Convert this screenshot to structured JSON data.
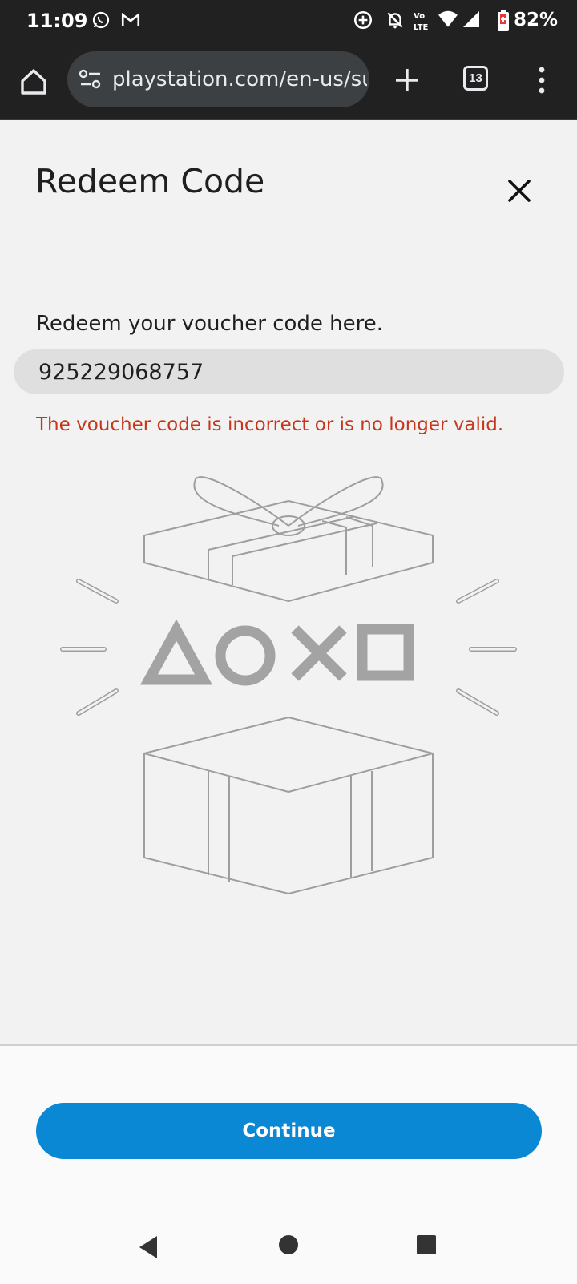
{
  "status_bar": {
    "time": "11:09",
    "battery": "82%",
    "icons": [
      "whatsapp-icon",
      "gmail-icon",
      "data-saver-icon",
      "bell-off-icon",
      "volte-icon",
      "wifi-icon",
      "signal-icon",
      "battery-icon"
    ]
  },
  "browser": {
    "url": "playstation.com/en-us/su",
    "tab_count": "13"
  },
  "dialog": {
    "title": "Redeem Code",
    "label": "Redeem your voucher code here.",
    "code_value": "925229068757",
    "error": "The voucher code is incorrect or is no longer valid.",
    "continue_label": "Continue"
  },
  "colors": {
    "accent": "#0a88d4",
    "error": "#c7361a",
    "page_bg": "#f2f2f2"
  }
}
